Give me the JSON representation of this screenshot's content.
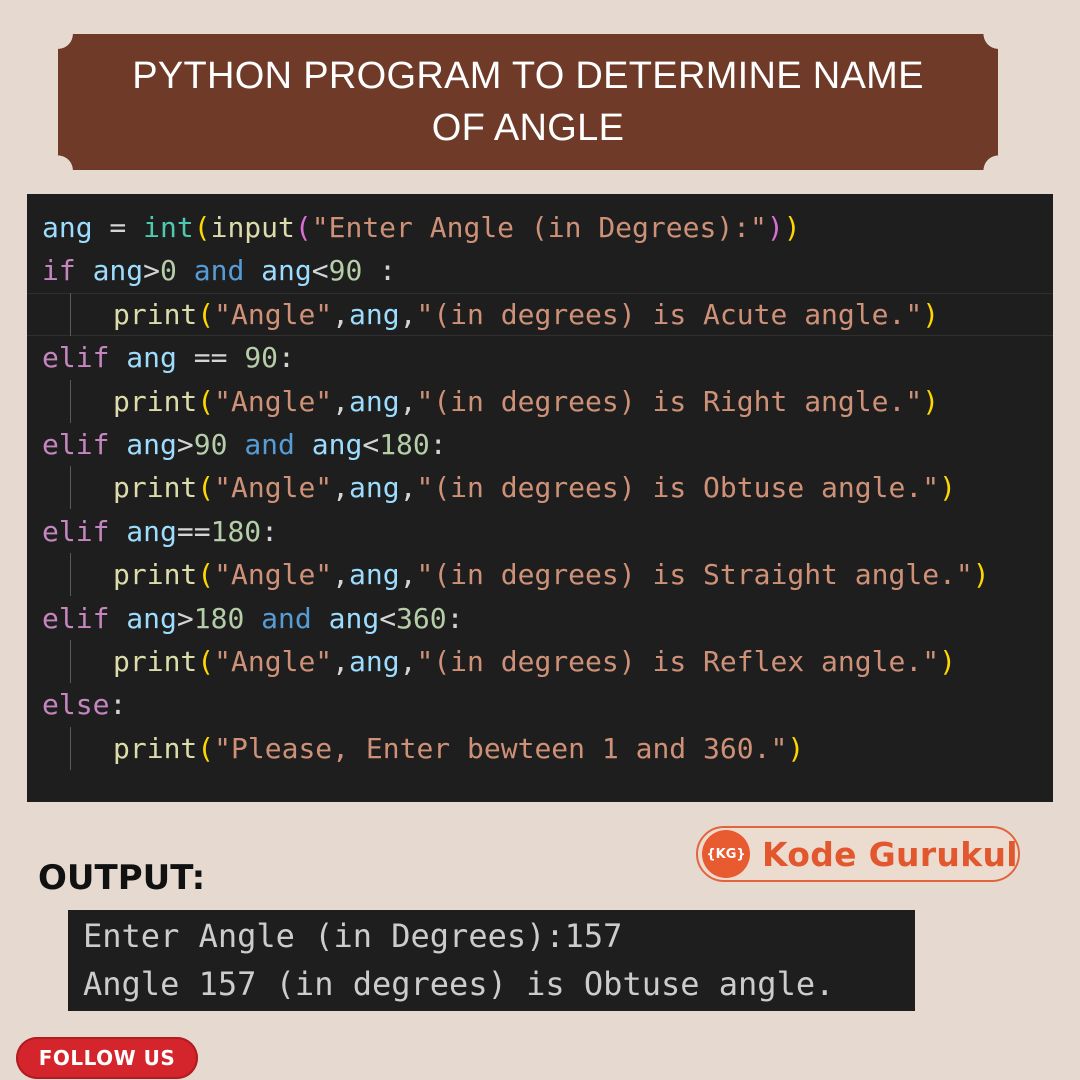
{
  "banner": {
    "title": "PYTHON PROGRAM TO DETERMINE NAME OF ANGLE"
  },
  "code": {
    "lines": [
      [
        [
          "var",
          "ang"
        ],
        [
          "op",
          " = "
        ],
        [
          "cls",
          "int"
        ],
        [
          "p1",
          "("
        ],
        [
          "fn",
          "input"
        ],
        [
          "p2",
          "("
        ],
        [
          "str",
          "\"Enter Angle (in Degrees):\""
        ],
        [
          "p2",
          ")"
        ],
        [
          "p1",
          ")"
        ]
      ],
      [
        [
          "kw",
          "if"
        ],
        [
          "op",
          " "
        ],
        [
          "var",
          "ang"
        ],
        [
          "op",
          ">"
        ],
        [
          "num",
          "0"
        ],
        [
          "op",
          " "
        ],
        [
          "bkw",
          "and"
        ],
        [
          "op",
          " "
        ],
        [
          "var",
          "ang"
        ],
        [
          "op",
          "<"
        ],
        [
          "num",
          "90"
        ],
        [
          "op",
          " :"
        ]
      ],
      [
        [
          "fn",
          "print"
        ],
        [
          "p1",
          "("
        ],
        [
          "str",
          "\"Angle\""
        ],
        [
          "op",
          ","
        ],
        [
          "var",
          "ang"
        ],
        [
          "op",
          ","
        ],
        [
          "str",
          "\"(in degrees) is Acute angle.\""
        ],
        [
          "p1",
          ")"
        ]
      ],
      [
        [
          "kw",
          "elif"
        ],
        [
          "op",
          " "
        ],
        [
          "var",
          "ang"
        ],
        [
          "op",
          " == "
        ],
        [
          "num",
          "90"
        ],
        [
          "op",
          ":"
        ]
      ],
      [
        [
          "fn",
          "print"
        ],
        [
          "p1",
          "("
        ],
        [
          "str",
          "\"Angle\""
        ],
        [
          "op",
          ","
        ],
        [
          "var",
          "ang"
        ],
        [
          "op",
          ","
        ],
        [
          "str",
          "\"(in degrees) is Right angle.\""
        ],
        [
          "p1",
          ")"
        ]
      ],
      [
        [
          "kw",
          "elif"
        ],
        [
          "op",
          " "
        ],
        [
          "var",
          "ang"
        ],
        [
          "op",
          ">"
        ],
        [
          "num",
          "90"
        ],
        [
          "op",
          " "
        ],
        [
          "bkw",
          "and"
        ],
        [
          "op",
          " "
        ],
        [
          "var",
          "ang"
        ],
        [
          "op",
          "<"
        ],
        [
          "num",
          "180"
        ],
        [
          "op",
          ":"
        ]
      ],
      [
        [
          "fn",
          "print"
        ],
        [
          "p1",
          "("
        ],
        [
          "str",
          "\"Angle\""
        ],
        [
          "op",
          ","
        ],
        [
          "var",
          "ang"
        ],
        [
          "op",
          ","
        ],
        [
          "str",
          "\"(in degrees) is Obtuse angle.\""
        ],
        [
          "p1",
          ")"
        ]
      ],
      [
        [
          "kw",
          "elif"
        ],
        [
          "op",
          " "
        ],
        [
          "var",
          "ang"
        ],
        [
          "op",
          "=="
        ],
        [
          "num",
          "180"
        ],
        [
          "op",
          ":"
        ]
      ],
      [
        [
          "fn",
          "print"
        ],
        [
          "p1",
          "("
        ],
        [
          "str",
          "\"Angle\""
        ],
        [
          "op",
          ","
        ],
        [
          "var",
          "ang"
        ],
        [
          "op",
          ","
        ],
        [
          "str",
          "\"(in degrees) is Straight angle.\""
        ],
        [
          "p1",
          ")"
        ]
      ],
      [
        [
          "kw",
          "elif"
        ],
        [
          "op",
          " "
        ],
        [
          "var",
          "ang"
        ],
        [
          "op",
          ">"
        ],
        [
          "num",
          "180"
        ],
        [
          "op",
          " "
        ],
        [
          "bkw",
          "and"
        ],
        [
          "op",
          " "
        ],
        [
          "var",
          "ang"
        ],
        [
          "op",
          "<"
        ],
        [
          "num",
          "360"
        ],
        [
          "op",
          ":"
        ]
      ],
      [
        [
          "fn",
          "print"
        ],
        [
          "p1",
          "("
        ],
        [
          "str",
          "\"Angle\""
        ],
        [
          "op",
          ","
        ],
        [
          "var",
          "ang"
        ],
        [
          "op",
          ","
        ],
        [
          "str",
          "\"(in degrees) is Reflex angle.\""
        ],
        [
          "p1",
          ")"
        ]
      ],
      [
        [
          "kw",
          "else"
        ],
        [
          "op",
          ":"
        ]
      ],
      [
        [
          "fn",
          "print"
        ],
        [
          "p1",
          "("
        ],
        [
          "str",
          "\"Please, Enter bewteen 1 and 360.\""
        ],
        [
          "p1",
          ")"
        ]
      ]
    ],
    "indented": [
      2,
      4,
      6,
      8,
      10,
      12
    ],
    "highlighted_line": 2,
    "colors": {
      "background": "#1e1e1e",
      "variable": "#9cdcfe",
      "keyword": "#c586c0",
      "bool_keyword": "#569cd6",
      "function": "#dcdcaa",
      "builtin_class": "#4ec9b0",
      "string": "#ce9178",
      "number": "#b5cea8",
      "bracket_1": "#ffd700",
      "bracket_2": "#da70d6"
    }
  },
  "brand": {
    "logo_text": "{KG}",
    "name": "Kode Gurukul",
    "color": "#e2572d"
  },
  "output": {
    "label": "OUTPUT:",
    "lines": [
      "Enter Angle (in Degrees):157",
      "Angle 157 (in degrees) is Obtuse angle."
    ]
  },
  "follow": {
    "label": "FOLLOW US",
    "color": "#d3252b"
  },
  "page": {
    "background": "#e6dad0",
    "banner_color": "#6f3a27"
  }
}
